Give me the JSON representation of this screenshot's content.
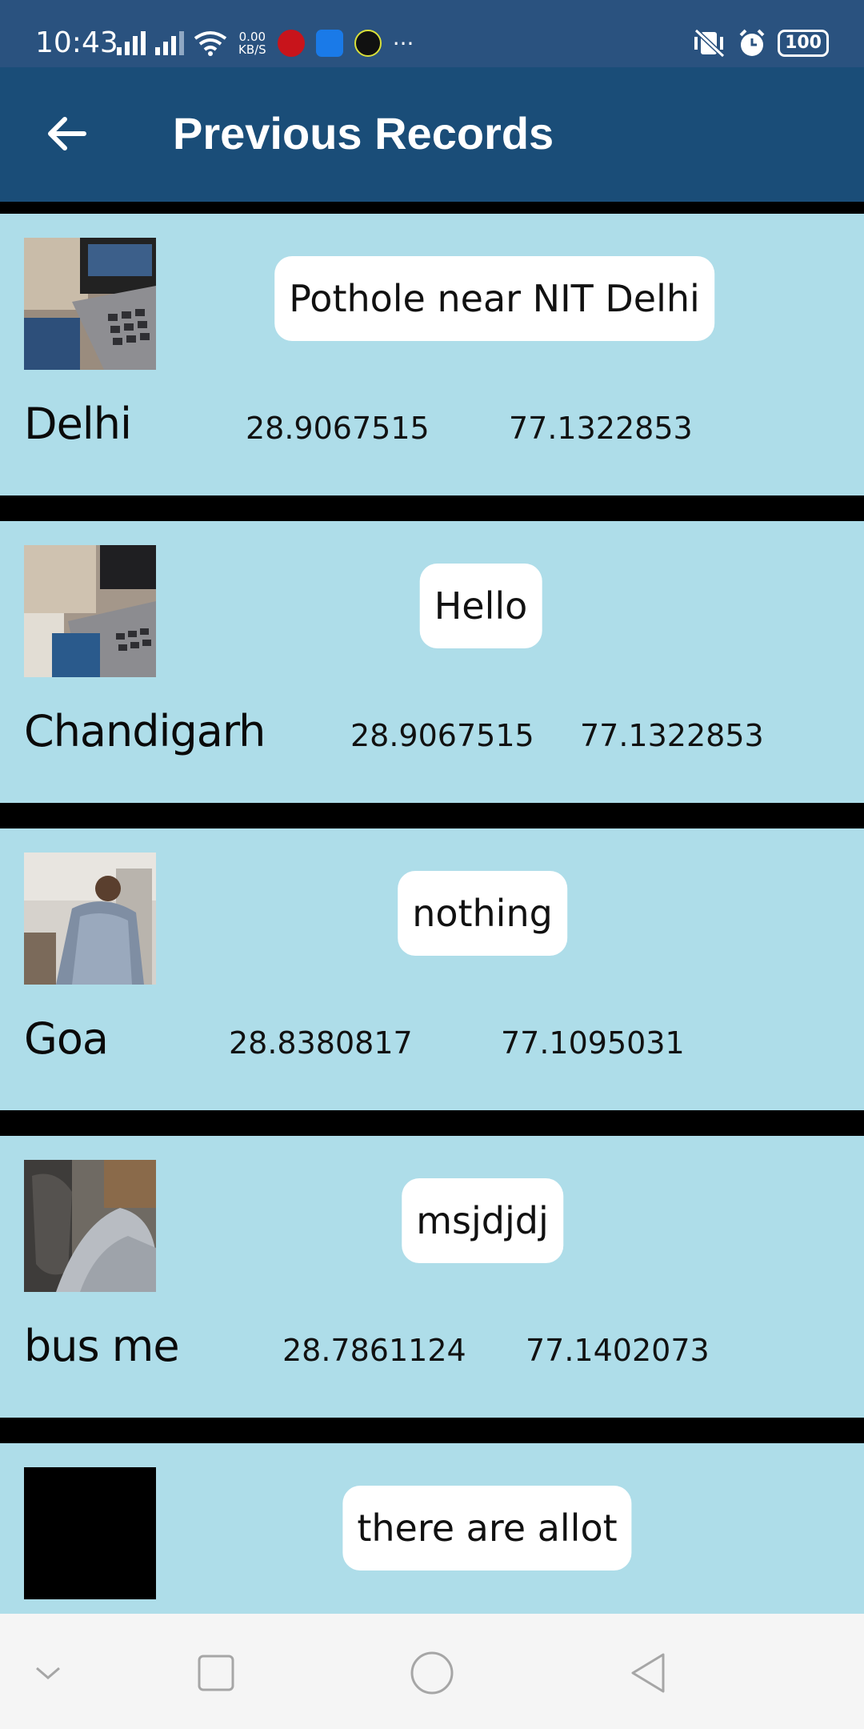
{
  "status_bar": {
    "time": "10:43",
    "net_speed_value": "0.00",
    "net_speed_unit": "KB/S",
    "more": "···",
    "battery": "100"
  },
  "app_bar": {
    "title": "Previous Records"
  },
  "records": [
    {
      "description": "Pothole near NIT Delhi",
      "place": "Delhi",
      "latitude": "28.9067515",
      "longitude": "77.1322853"
    },
    {
      "description": "Hello",
      "place": "Chandigarh",
      "latitude": "28.9067515",
      "longitude": "77.1322853"
    },
    {
      "description": "nothing",
      "place": "Goa",
      "latitude": "28.8380817",
      "longitude": "77.1095031"
    },
    {
      "description": "msjdjdj",
      "place": "bus me",
      "latitude": "28.7861124",
      "longitude": "77.1402073"
    },
    {
      "description": "there are allot"
    }
  ],
  "colors": {
    "status_bar": "#2a527f",
    "app_bar": "#1a4d78",
    "card": "#aedde9",
    "separator": "#000000",
    "nav_bar": "#f5f5f5"
  },
  "icons": {
    "back": "arrow-left-icon",
    "nav": [
      "chevron-down-icon",
      "square-icon",
      "circle-icon",
      "triangle-back-icon"
    ]
  }
}
